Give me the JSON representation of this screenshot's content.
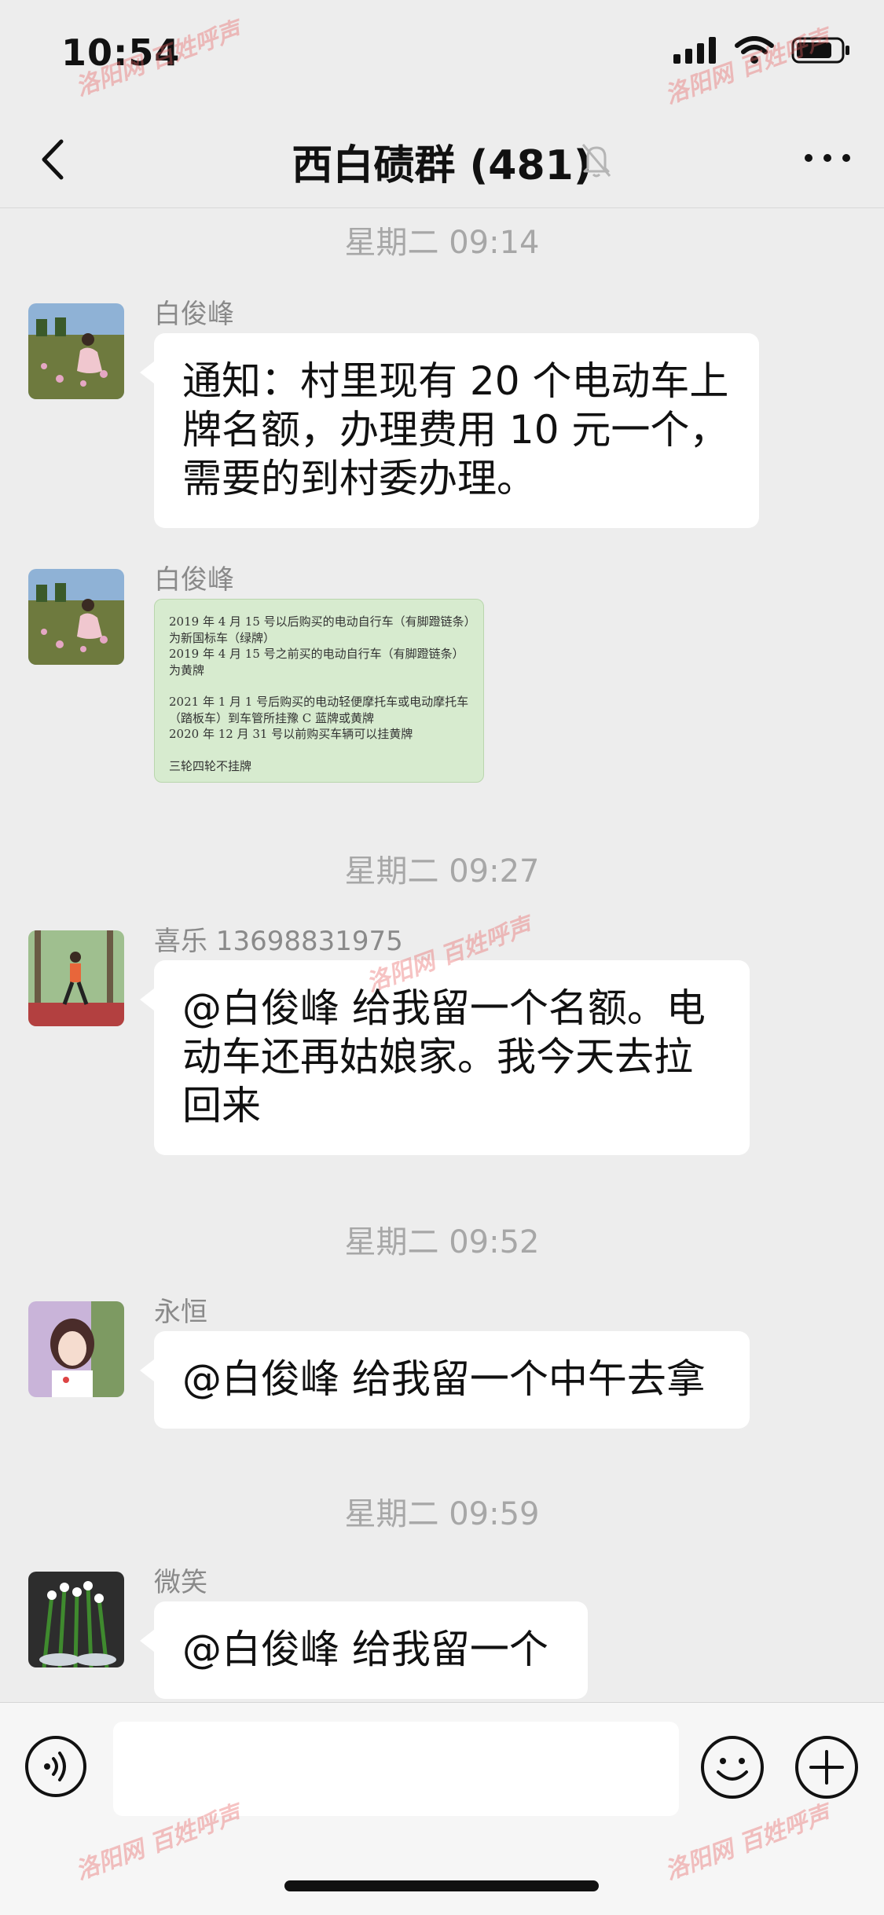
{
  "status_bar": {
    "time": "10:54"
  },
  "header": {
    "title": "西白碛群 (481)"
  },
  "watermark": "洛阳网 百姓呼声",
  "messages": [
    {
      "timestamp": "星期二 09:14",
      "sender": "白俊峰",
      "text": "通知：村里现有 20 个电动车上牌名额，办理费用 10 元一个，需要的到村委办理。"
    },
    {
      "sender": "白俊峰",
      "image_text": [
        "2019 年 4 月 15 号以后购买的电动自行车（有脚蹬链条）",
        "为新国标车（绿牌）",
        "2019 年 4 月 15 号之前买的电动自行车（有脚蹬链条）",
        "为黄牌",
        "",
        "2021 年 1 月 1 号后购买的电动轻便摩托车或电动摩托车",
        "（踏板车）到车管所挂豫 C 蓝牌或黄牌",
        "2020 年 12 月 31 号以前购买车辆可以挂黄牌",
        "",
        "三轮四轮不挂牌"
      ]
    },
    {
      "timestamp": "星期二 09:27",
      "sender": "喜乐 13698831975",
      "text": "@白俊峰 给我留一个名额。电动车还再姑娘家。我今天去拉回来"
    },
    {
      "timestamp": "星期二 09:52",
      "sender": "永恒",
      "text": "@白俊峰 给我留一个中午去拿"
    },
    {
      "timestamp": "星期二 09:59",
      "sender": "微笑",
      "text": "@白俊峰 给我留一个"
    }
  ]
}
